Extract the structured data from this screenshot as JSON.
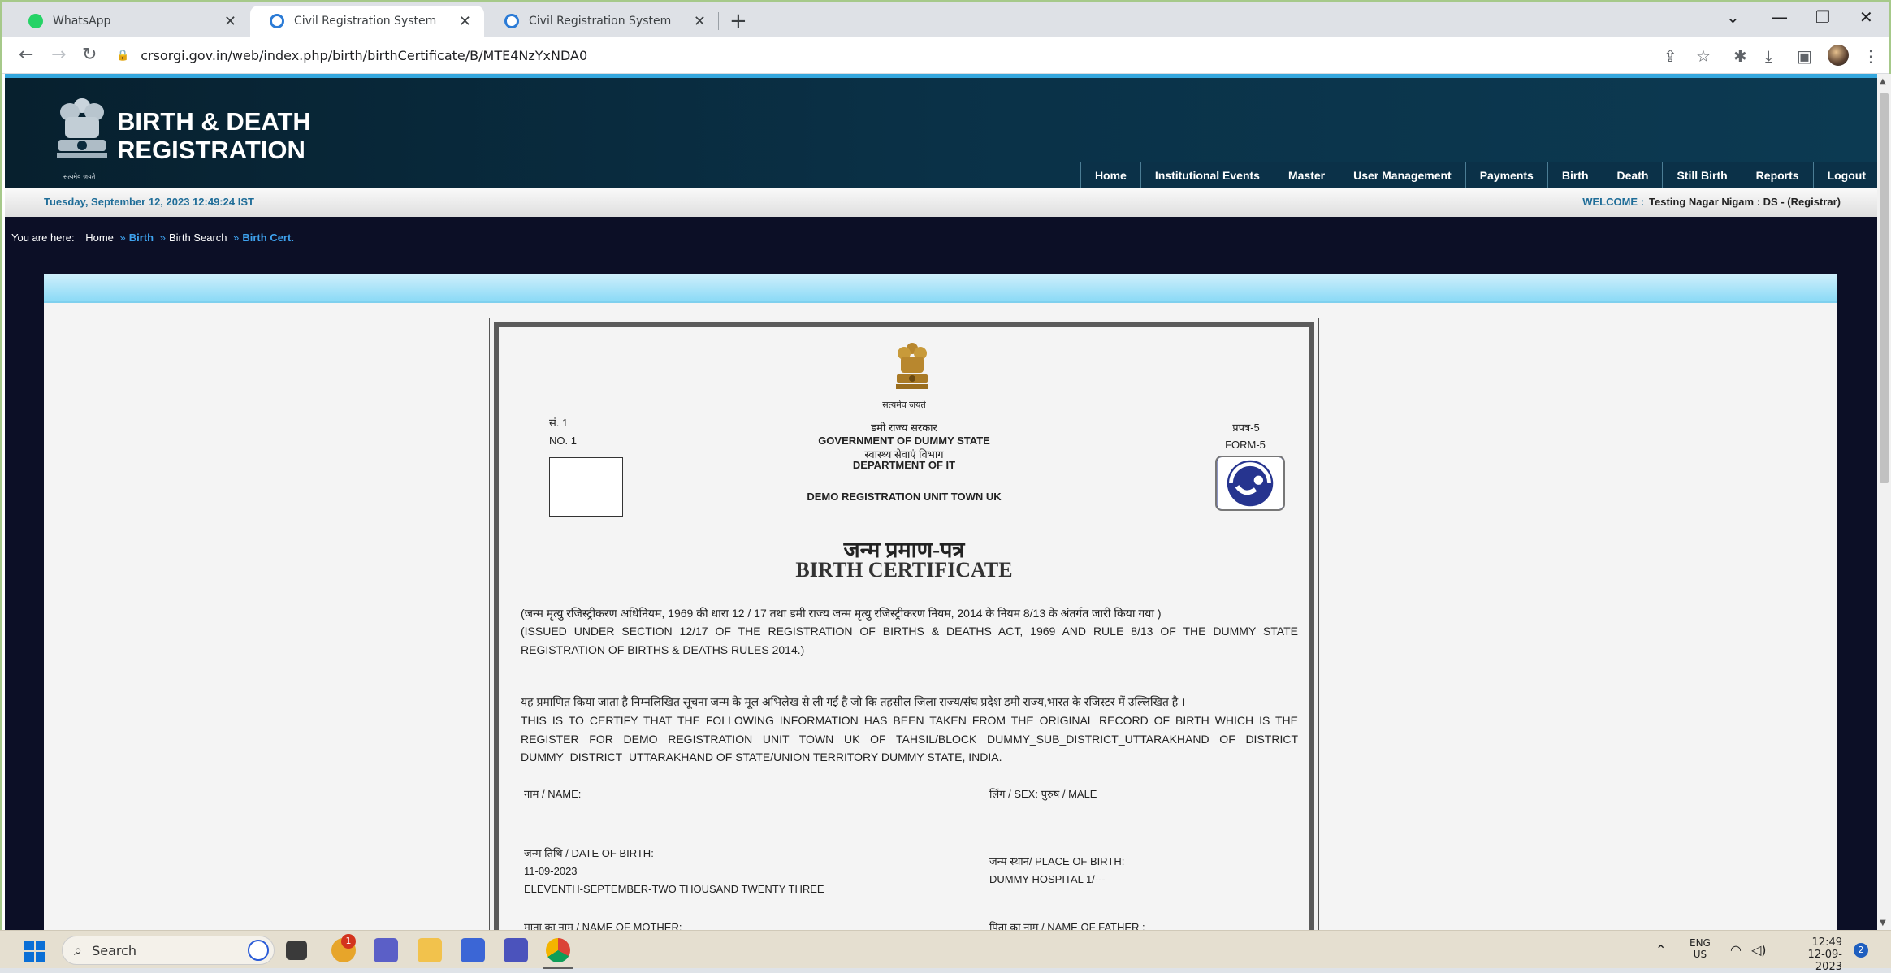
{
  "browser": {
    "tabs": [
      {
        "title": "WhatsApp",
        "active": false
      },
      {
        "title": "Civil Registration System",
        "active": true
      },
      {
        "title": "Civil Registration System",
        "active": false
      }
    ],
    "url": "crsorgi.gov.in/web/index.php/birth/birthCertificate/B/MTE4NzYxNDA0"
  },
  "site": {
    "brand_line1": "BIRTH & DEATH",
    "brand_line2": "REGISTRATION",
    "emblem_caption": "सत्यमेव जयते",
    "menu": [
      "Home",
      "Institutional Events",
      "Master",
      "User Management",
      "Payments",
      "Birth",
      "Death",
      "Still Birth",
      "Reports",
      "Logout"
    ],
    "datetime": "Tuesday, September 12, 2023 12:49:24 IST",
    "welcome_label": "WELCOME :",
    "welcome_user": "Testing Nagar Nigam : DS -  (Registrar)",
    "breadcrumb": {
      "prefix": "You are here:",
      "home": "Home",
      "birth": "Birth",
      "search": "Birth Search",
      "current": "Birth Cert."
    }
  },
  "certificate": {
    "satyamev": "सत्यमेव जयते",
    "no_hi": "सं. 1",
    "no_en": "NO. 1",
    "form_hi": "प्रपत्र-5",
    "form_en": "FORM-5",
    "gov_hi": "डमी राज्य सरकार",
    "gov_en": "GOVERNMENT OF DUMMY STATE",
    "dept_hi": "स्वास्थ्य सेवाएं विभाग",
    "dept_en": "DEPARTMENT OF IT",
    "unit": "DEMO REGISTRATION UNIT TOWN UK",
    "title_hi": "जन्म प्रमाण-पत्र",
    "title_en": "BIRTH CERTIFICATE",
    "issued_hi": "(जन्म मृत्यु रजिस्ट्रीकरण अधिनियम, 1969 की धारा 12 / 17 तथा डमी राज्य जन्म मृत्यु रजिस्ट्रीकरण नियम, 2014 के नियम 8/13 के अंतर्गत जारी किया गया )",
    "issued_en": "(ISSUED UNDER SECTION 12/17 OF THE REGISTRATION OF BIRTHS & DEATHS ACT, 1969 AND RULE 8/13 OF THE DUMMY STATE REGISTRATION OF BIRTHS & DEATHS RULES 2014.)",
    "certify_hi": "यह प्रमाणित किया जाता है निम्नलिखित सूचना जन्म के मूल अभिलेख से ली गई है जो कि तहसील जिला राज्य/संघ प्रदेश डमी राज्य,भारत के रजिस्टर में उल्लिखित है ।",
    "certify_en": "THIS IS TO CERTIFY THAT THE FOLLOWING INFORMATION HAS BEEN TAKEN FROM THE ORIGINAL RECORD OF BIRTH WHICH IS THE REGISTER FOR DEMO REGISTRATION UNIT TOWN UK OF TAHSIL/BLOCK DUMMY_SUB_DISTRICT_UTTARAKHAND OF DISTRICT DUMMY_DISTRICT_UTTARAKHAND OF STATE/UNION TERRITORY DUMMY STATE, INDIA.",
    "name_label": "नाम / NAME:",
    "sex_label": "लिंग / SEX: पुरुष / MALE",
    "dob_label": "जन्म तिथि / DATE OF BIRTH:",
    "dob_value": "11-09-2023",
    "dob_words": "ELEVENTH-SEPTEMBER-TWO THOUSAND TWENTY THREE",
    "pob_label": "जन्म स्थान/ PLACE OF BIRTH:",
    "pob_value": "DUMMY HOSPITAL 1/---",
    "mother_label": "माता का नाम / NAME OF MOTHER:",
    "father_label": "पिता का नाम / NAME OF FATHER :"
  },
  "taskbar": {
    "search": "Search",
    "lang1": "ENG",
    "lang2": "US",
    "time": "12:49",
    "date": "12-09-2023",
    "notif_count": "2",
    "badge": "1"
  }
}
